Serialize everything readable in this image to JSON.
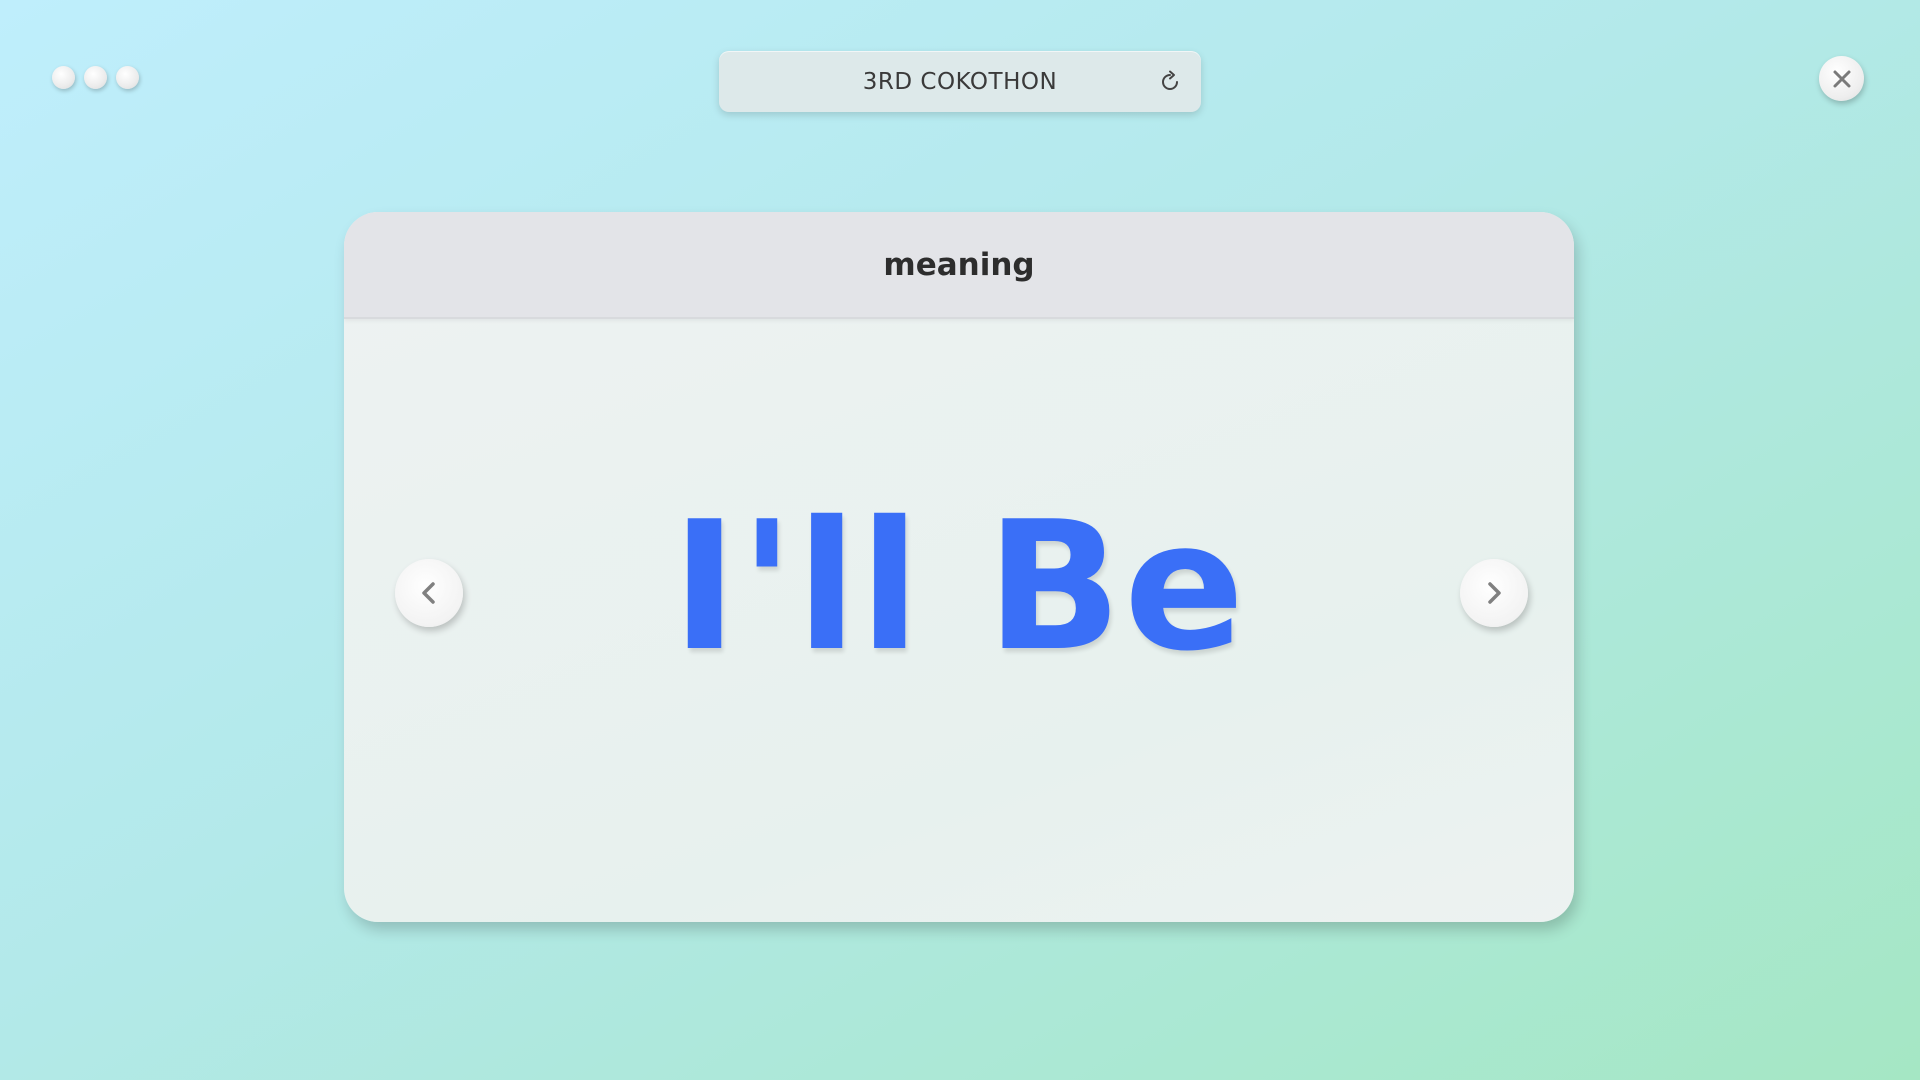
{
  "title_bar": {
    "title": "3RD COKOTHON",
    "refresh_icon": "refresh-icon"
  },
  "window_controls": {
    "dots": [
      "dot",
      "dot",
      "dot"
    ],
    "close_icon": "close-icon"
  },
  "card": {
    "header_label": "meaning",
    "word": "I'll Be",
    "prev_icon": "chevron-left-icon",
    "next_icon": "chevron-right-icon"
  },
  "colors": {
    "word": "#3a6ff7",
    "background_start": "#bfeefc",
    "background_end": "#a5e7c4",
    "card": "#eef2f2",
    "card_header": "#e3e4e8"
  }
}
